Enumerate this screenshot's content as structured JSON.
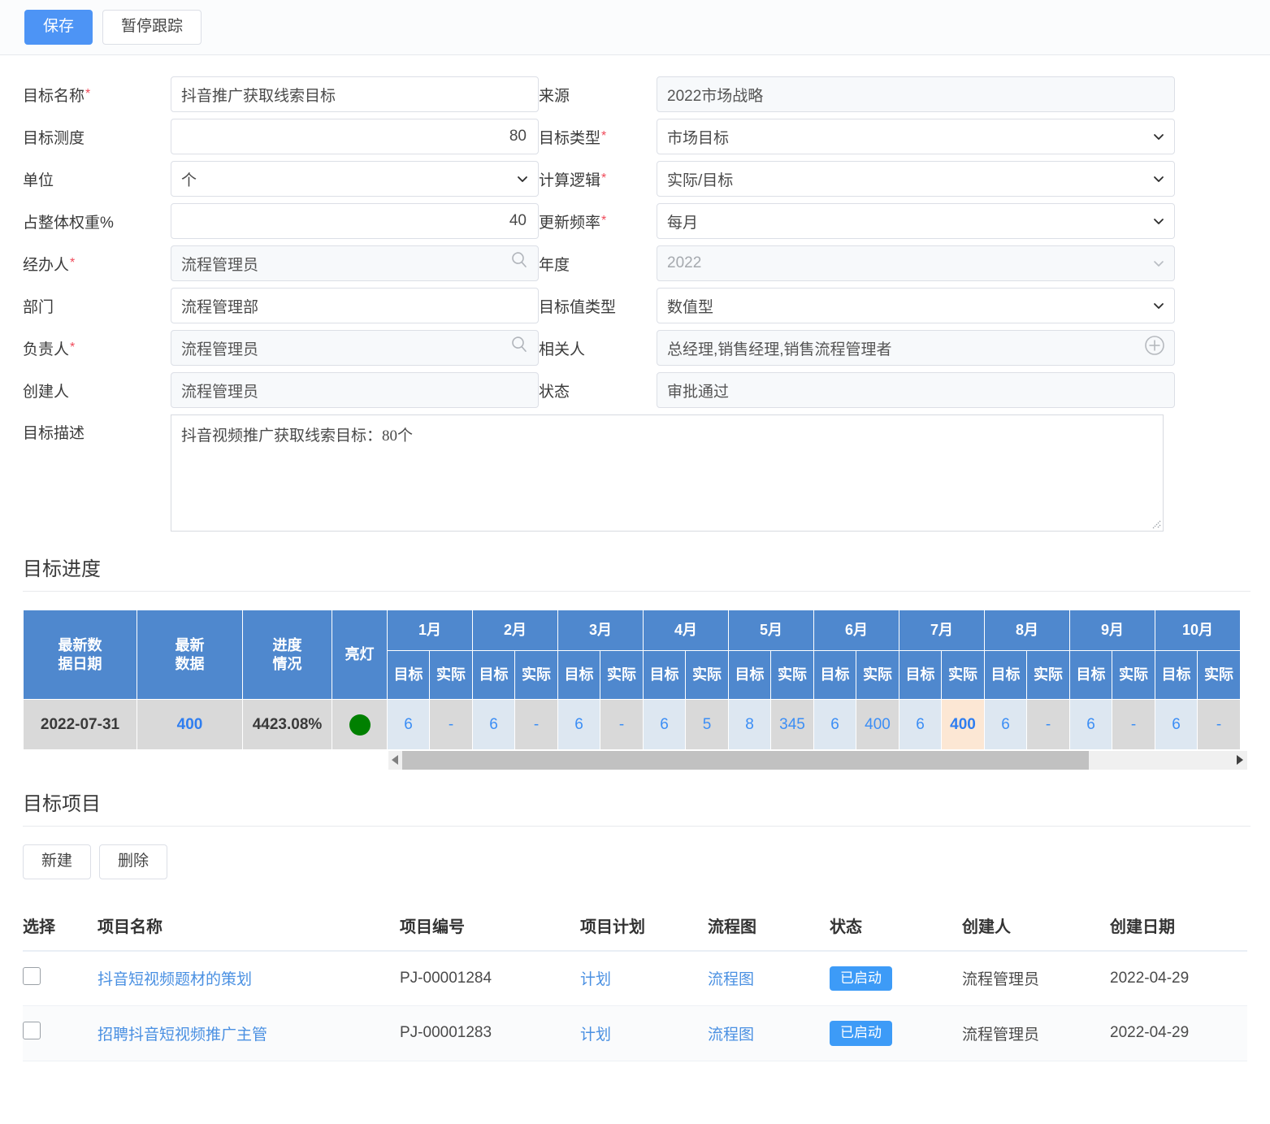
{
  "toolbar": {
    "save_label": "保存",
    "pause_label": "暂停跟踪"
  },
  "form": {
    "left": [
      {
        "label": "目标名称",
        "required": true,
        "value": "抖音推广获取线索目标",
        "type": "text",
        "readonly": false,
        "align": "left"
      },
      {
        "label": "目标测度",
        "required": false,
        "value": "80",
        "type": "number",
        "readonly": false,
        "align": "right"
      },
      {
        "label": "单位",
        "required": false,
        "value": "个",
        "type": "select",
        "readonly": false,
        "align": "left"
      },
      {
        "label": "占整体权重%",
        "required": false,
        "value": "40",
        "type": "number",
        "readonly": false,
        "align": "right"
      },
      {
        "label": "经办人",
        "required": true,
        "value": "流程管理员",
        "type": "lookup",
        "readonly": true,
        "align": "left"
      },
      {
        "label": "部门",
        "required": false,
        "value": "流程管理部",
        "type": "text",
        "readonly": false,
        "align": "left"
      },
      {
        "label": "负责人",
        "required": true,
        "value": "流程管理员",
        "type": "lookup",
        "readonly": true,
        "align": "left"
      },
      {
        "label": "创建人",
        "required": false,
        "value": "流程管理员",
        "type": "text",
        "readonly": true,
        "align": "left"
      }
    ],
    "right": [
      {
        "label": "来源",
        "required": false,
        "value": "2022市场战略",
        "type": "text",
        "readonly": true,
        "align": "left"
      },
      {
        "label": "目标类型",
        "required": true,
        "value": "市场目标",
        "type": "select",
        "readonly": false,
        "align": "left"
      },
      {
        "label": "计算逻辑",
        "required": true,
        "value": "实际/目标",
        "type": "select",
        "readonly": false,
        "align": "left"
      },
      {
        "label": "更新频率",
        "required": true,
        "value": "每月",
        "type": "select",
        "readonly": false,
        "align": "left"
      },
      {
        "label": "年度",
        "required": false,
        "value": "2022",
        "type": "select",
        "readonly": true,
        "align": "left",
        "disabled": true
      },
      {
        "label": "目标值类型",
        "required": false,
        "value": "数值型",
        "type": "select",
        "readonly": false,
        "align": "left"
      },
      {
        "label": "相关人",
        "required": false,
        "value": "总经理,销售经理,销售流程管理者",
        "type": "multi",
        "readonly": true,
        "align": "left"
      },
      {
        "label": "状态",
        "required": false,
        "value": "审批通过",
        "type": "text",
        "readonly": true,
        "align": "left"
      }
    ],
    "description": {
      "label": "目标描述",
      "value": "抖音视频推广获取线索目标：80个"
    }
  },
  "progress_section": {
    "title": "目标进度",
    "fixed_headers": [
      "最新数\n据日期",
      "最新\n数据",
      "进度\n情况",
      "亮灯"
    ],
    "fixed_headers_flat": [
      "最新数据日期",
      "最新数据",
      "进度情况",
      "亮灯"
    ],
    "sub_headers": {
      "target": "目标",
      "actual": "实际"
    },
    "row": {
      "latest_date": "2022-07-31",
      "latest_value": "400",
      "progress": "4423.08%",
      "light_color": "#008000"
    },
    "months": [
      {
        "label": "1月",
        "target": "6",
        "actual": "-",
        "highlight": false
      },
      {
        "label": "2月",
        "target": "6",
        "actual": "-",
        "highlight": false
      },
      {
        "label": "3月",
        "target": "6",
        "actual": "-",
        "highlight": false
      },
      {
        "label": "4月",
        "target": "6",
        "actual": "5",
        "highlight": false
      },
      {
        "label": "5月",
        "target": "8",
        "actual": "345",
        "highlight": false
      },
      {
        "label": "6月",
        "target": "6",
        "actual": "400",
        "highlight": false
      },
      {
        "label": "7月",
        "target": "6",
        "actual": "400",
        "highlight": true
      },
      {
        "label": "8月",
        "target": "6",
        "actual": "-",
        "highlight": false
      },
      {
        "label": "9月",
        "target": "6",
        "actual": "-",
        "highlight": false
      },
      {
        "label": "10月",
        "target": "6",
        "actual": "-",
        "highlight": false
      }
    ]
  },
  "project_section": {
    "title": "目标项目",
    "new_label": "新建",
    "delete_label": "删除",
    "columns": [
      "选择",
      "项目名称",
      "项目编号",
      "项目计划",
      "流程图",
      "状态",
      "创建人",
      "创建日期"
    ],
    "rows": [
      {
        "name": "抖音短视频题材的策划",
        "code": "PJ-00001284",
        "plan": "计划",
        "flow": "流程图",
        "status": "已启动",
        "creator": "流程管理员",
        "created": "2022-04-29"
      },
      {
        "name": "招聘抖音短视频推广主管",
        "code": "PJ-00001283",
        "plan": "计划",
        "flow": "流程图",
        "status": "已启动",
        "creator": "流程管理员",
        "created": "2022-04-29"
      }
    ]
  },
  "colors": {
    "primary": "#4d94f5",
    "table_header": "#4f88ce",
    "target_cell": "#dde7f1",
    "actual_cell": "#d9d9d9",
    "highlight_cell": "#fce7d4",
    "light_green": "#008000",
    "link": "#4a90e2",
    "required_star": "#f04a5a"
  }
}
